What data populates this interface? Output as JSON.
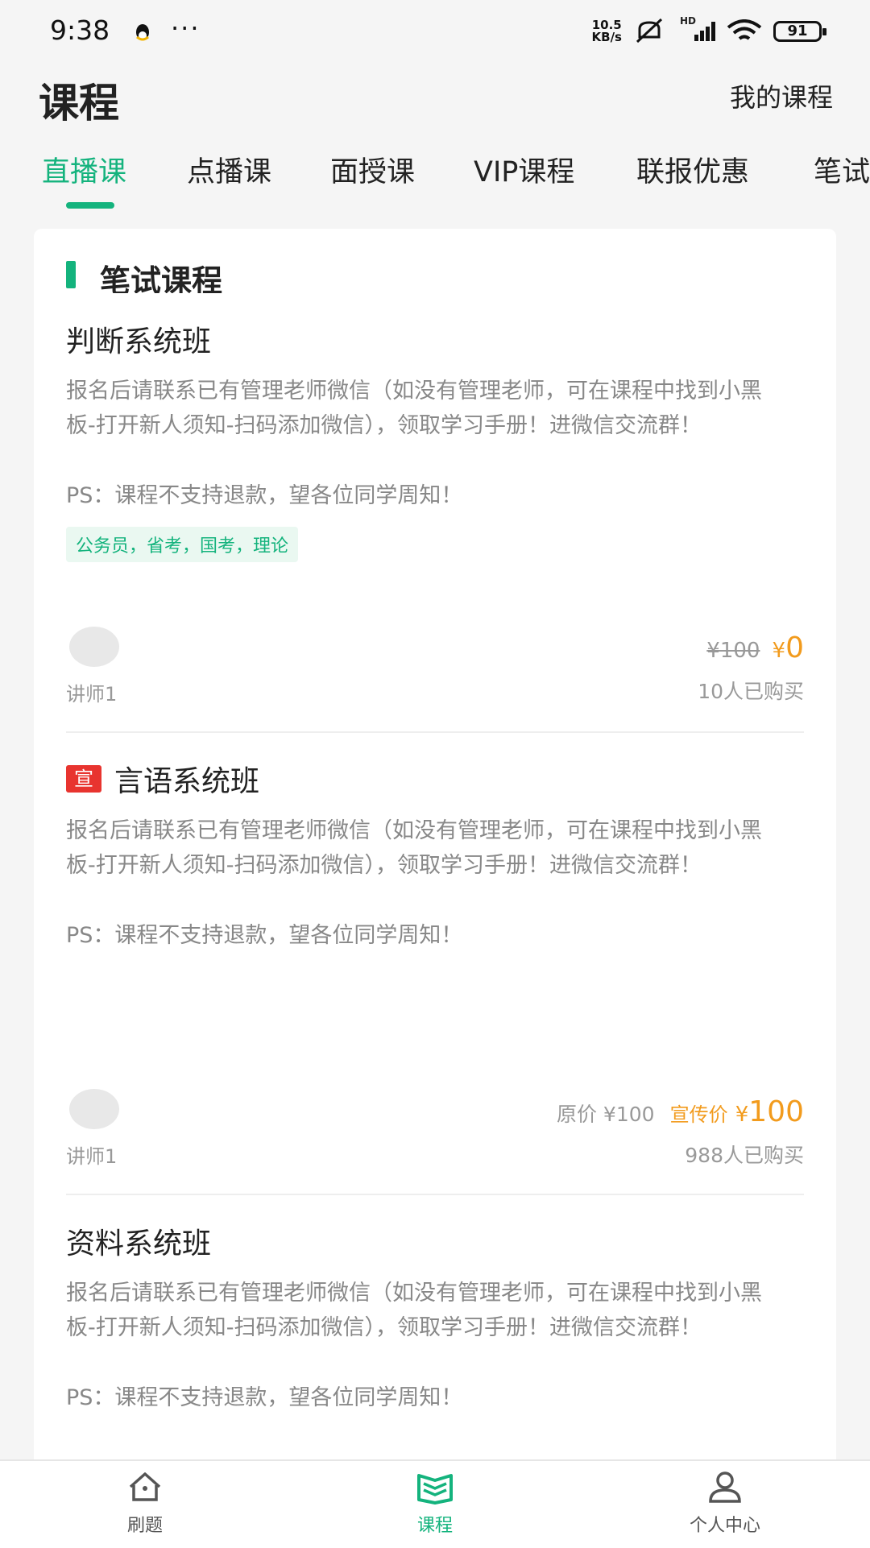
{
  "status_bar": {
    "time": "9:38",
    "dots": "···",
    "net_speed_top": "10.5",
    "net_speed_bottom": "KB/s",
    "hd": "HD",
    "battery": "91"
  },
  "header": {
    "title": "课程",
    "my_courses": "我的课程"
  },
  "tabs": [
    {
      "label": "直播课",
      "active": true
    },
    {
      "label": "点播课"
    },
    {
      "label": "面授课"
    },
    {
      "label": "VIP课程"
    },
    {
      "label": "联报优惠"
    },
    {
      "label": "笔试"
    }
  ],
  "section": {
    "title": "笔试课程"
  },
  "courses": [
    {
      "title": "判断系统班",
      "desc": "报名后请联系已有管理老师微信（如没有管理老师，可在课程中找到小黑板-打开新人须知-扫码添加微信），领取学习手册！进微信交流群！",
      "ps": "PS：课程不支持退款，望各位同学周知！",
      "tags": "公务员，省考，国考，理论",
      "teacher": "讲师1",
      "old_price": "¥100",
      "price_symbol": "¥",
      "price": "0",
      "buyers": "10人已购买"
    },
    {
      "promo_tag": "宣",
      "title": "言语系统班",
      "desc": "报名后请联系已有管理老师微信（如没有管理老师，可在课程中找到小黑板-打开新人须知-扫码添加微信），领取学习手册！进微信交流群！",
      "ps": "PS：课程不支持退款，望各位同学周知！",
      "teacher": "讲师1",
      "orig_label": "原价 ¥100",
      "promo_label": "宣传价",
      "price_symbol": "¥",
      "price": "100",
      "buyers": "988人已购买"
    },
    {
      "title": "资料系统班",
      "desc": "报名后请联系已有管理老师微信（如没有管理老师，可在课程中找到小黑板-打开新人须知-扫码添加微信），领取学习手册！进微信交流群！",
      "ps": "PS：课程不支持退款，望各位同学周知！"
    }
  ],
  "bottom_nav": [
    {
      "label": "刷题",
      "icon": "home-icon"
    },
    {
      "label": "课程",
      "icon": "book-icon",
      "active": true
    },
    {
      "label": "个人中心",
      "icon": "person-icon"
    }
  ],
  "colors": {
    "accent": "#14b37d",
    "price": "#f29b1d",
    "promo_tag": "#e8342f",
    "background": "#f5f5f5"
  }
}
